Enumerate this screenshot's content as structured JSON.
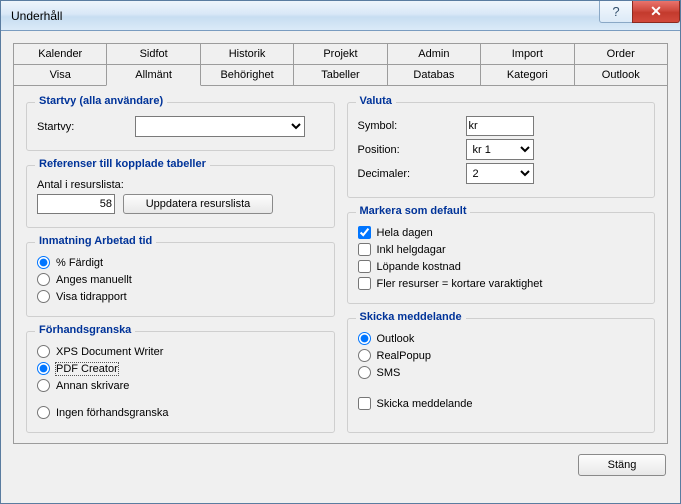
{
  "window": {
    "title": "Underhåll",
    "help_icon": "?",
    "close_icon": "✕"
  },
  "tabs_row1": [
    "Kalender",
    "Sidfot",
    "Historik",
    "Projekt",
    "Admin",
    "Import",
    "Order"
  ],
  "tabs_row2": [
    "Visa",
    "Allmänt",
    "Behörighet",
    "Tabeller",
    "Databas",
    "Kategori",
    "Outlook"
  ],
  "active_tab": "Allmänt",
  "startvy": {
    "legend": "Startvy (alla användare)",
    "label": "Startvy:",
    "value": ""
  },
  "referenser": {
    "legend": "Referenser till kopplade tabeller",
    "label": "Antal i resurslista:",
    "value": "58",
    "button": "Uppdatera resurslista"
  },
  "inmatning": {
    "legend": "Inmatning Arbetad tid",
    "options": [
      "% Färdigt",
      "Anges manuellt",
      "Visa tidrapport"
    ],
    "selected": 0
  },
  "forhand": {
    "legend": "Förhandsgranska",
    "options": [
      "XPS Document Writer",
      "PDF Creator",
      "Annan skrivare",
      "Ingen förhandsgranska"
    ],
    "selected": 1
  },
  "valuta": {
    "legend": "Valuta",
    "symbol_label": "Symbol:",
    "symbol_value": "kr",
    "position_label": "Position:",
    "position_value": "kr 1",
    "decimaler_label": "Decimaler:",
    "decimaler_value": "2"
  },
  "markera": {
    "legend": "Markera som default",
    "options": [
      {
        "label": "Hela dagen",
        "checked": true
      },
      {
        "label": "Inkl helgdagar",
        "checked": false
      },
      {
        "label": "Löpande kostnad",
        "checked": false
      },
      {
        "label": "Fler resurser = kortare varaktighet",
        "checked": false
      }
    ]
  },
  "skicka": {
    "legend": "Skicka meddelande",
    "options": [
      "Outlook",
      "RealPopup",
      "SMS"
    ],
    "selected": 0,
    "checkbox_label": "Skicka meddelande",
    "checkbox_checked": false
  },
  "footer": {
    "close": "Stäng"
  }
}
